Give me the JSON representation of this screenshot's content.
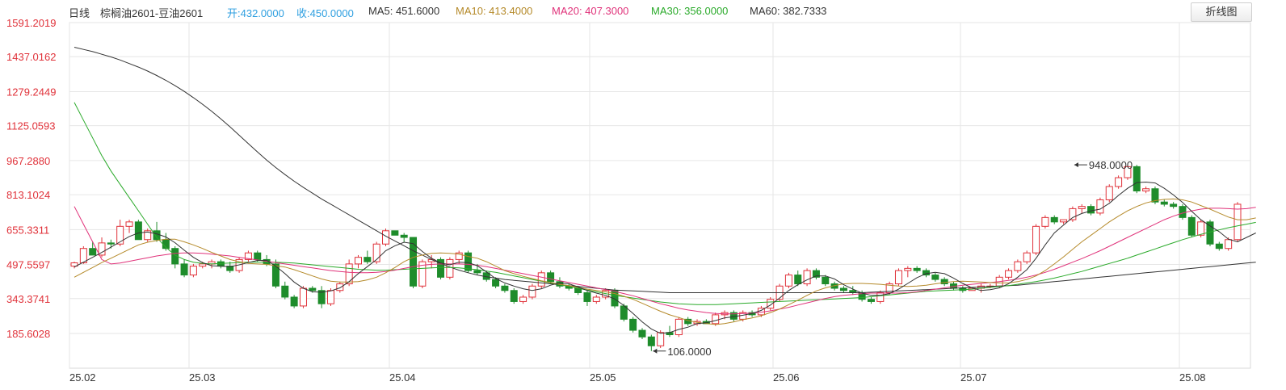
{
  "header": {
    "period": "日线",
    "instrument": "棕榈油2601-豆油2601",
    "open": "开:432.0000",
    "close": "收:450.0000",
    "ma5": "MA5: 451.6000",
    "ma10": "MA10: 413.4000",
    "ma20": "MA20: 407.3000",
    "ma30": "MA30: 356.0000",
    "ma60": "MA60: 382.7333",
    "toggle_label": "折线图"
  },
  "colors": {
    "up": "#e0323a",
    "down": "#1e8c2b",
    "open": "#2f9fe0",
    "close": "#2f9fe0",
    "ma5": "#333333",
    "ma10": "#b58a2a",
    "ma20": "#e0327a",
    "ma30": "#2aaa2a",
    "ma60": "#333333",
    "grid": "#e6e6e6"
  },
  "chart_data": {
    "type": "candlestick",
    "y_ticks": [
      "1591.2019",
      "1437.0162",
      "1279.2449",
      "1125.0593",
      "967.2880",
      "813.1024",
      "655.3311",
      "497.5597",
      "343.3741",
      "185.6028"
    ],
    "x_ticks": [
      "25.02",
      "25.03",
      "25.04",
      "25.05",
      "25.06",
      "25.07",
      "25.08"
    ],
    "annotations": [
      {
        "label": "948.0000",
        "value": 948,
        "index": 109
      },
      {
        "label": "106.0000",
        "value": 106,
        "index": 63
      }
    ],
    "ohlc": [
      [
        490,
        510,
        480,
        505
      ],
      [
        505,
        580,
        500,
        570
      ],
      [
        570,
        600,
        540,
        540
      ],
      [
        540,
        620,
        530,
        595
      ],
      [
        595,
        610,
        570,
        590
      ],
      [
        590,
        700,
        580,
        670
      ],
      [
        670,
        700,
        640,
        690
      ],
      [
        690,
        700,
        610,
        610
      ],
      [
        610,
        660,
        600,
        650
      ],
      [
        650,
        690,
        600,
        610
      ],
      [
        610,
        640,
        560,
        570
      ],
      [
        570,
        580,
        480,
        500
      ],
      [
        500,
        520,
        440,
        450
      ],
      [
        450,
        500,
        440,
        490
      ],
      [
        490,
        510,
        480,
        500
      ],
      [
        500,
        520,
        480,
        510
      ],
      [
        510,
        520,
        480,
        490
      ],
      [
        490,
        510,
        460,
        470
      ],
      [
        470,
        530,
        460,
        520
      ],
      [
        520,
        560,
        510,
        550
      ],
      [
        550,
        560,
        510,
        520
      ],
      [
        520,
        540,
        490,
        500
      ],
      [
        500,
        520,
        390,
        400
      ],
      [
        400,
        420,
        340,
        350
      ],
      [
        350,
        360,
        300,
        310
      ],
      [
        310,
        400,
        300,
        390
      ],
      [
        390,
        400,
        370,
        380
      ],
      [
        380,
        400,
        300,
        320
      ],
      [
        320,
        390,
        310,
        380
      ],
      [
        380,
        420,
        370,
        410
      ],
      [
        410,
        520,
        400,
        500
      ],
      [
        500,
        540,
        480,
        530
      ],
      [
        530,
        560,
        500,
        510
      ],
      [
        510,
        600,
        500,
        590
      ],
      [
        590,
        660,
        580,
        650
      ],
      [
        650,
        650,
        630,
        630
      ],
      [
        630,
        640,
        600,
        620
      ],
      [
        620,
        600,
        390,
        400
      ],
      [
        400,
        520,
        390,
        510
      ],
      [
        510,
        540,
        480,
        520
      ],
      [
        520,
        530,
        430,
        440
      ],
      [
        440,
        530,
        430,
        520
      ],
      [
        520,
        560,
        500,
        550
      ],
      [
        550,
        560,
        460,
        470
      ],
      [
        470,
        500,
        450,
        460
      ],
      [
        460,
        470,
        420,
        430
      ],
      [
        430,
        440,
        390,
        400
      ],
      [
        400,
        410,
        370,
        380
      ],
      [
        380,
        390,
        320,
        330
      ],
      [
        330,
        360,
        320,
        350
      ],
      [
        350,
        410,
        340,
        400
      ],
      [
        400,
        470,
        390,
        460
      ],
      [
        460,
        470,
        410,
        420
      ],
      [
        420,
        440,
        390,
        400
      ],
      [
        400,
        410,
        380,
        390
      ],
      [
        390,
        400,
        360,
        370
      ],
      [
        370,
        380,
        310,
        330
      ],
      [
        330,
        360,
        320,
        350
      ],
      [
        350,
        390,
        340,
        380
      ],
      [
        380,
        390,
        300,
        310
      ],
      [
        310,
        320,
        240,
        250
      ],
      [
        250,
        260,
        190,
        200
      ],
      [
        200,
        210,
        160,
        170
      ],
      [
        170,
        180,
        106,
        130
      ],
      [
        130,
        200,
        120,
        190
      ],
      [
        190,
        220,
        170,
        180
      ],
      [
        180,
        260,
        170,
        250
      ],
      [
        250,
        260,
        220,
        230
      ],
      [
        230,
        250,
        220,
        240
      ],
      [
        240,
        250,
        230,
        230
      ],
      [
        230,
        280,
        220,
        270
      ],
      [
        270,
        290,
        250,
        280
      ],
      [
        280,
        290,
        240,
        250
      ],
      [
        250,
        290,
        240,
        280
      ],
      [
        280,
        290,
        260,
        270
      ],
      [
        270,
        310,
        260,
        300
      ],
      [
        300,
        350,
        290,
        340
      ],
      [
        340,
        410,
        330,
        400
      ],
      [
        400,
        460,
        390,
        450
      ],
      [
        450,
        470,
        400,
        410
      ],
      [
        410,
        480,
        400,
        470
      ],
      [
        470,
        480,
        430,
        440
      ],
      [
        440,
        450,
        400,
        410
      ],
      [
        410,
        420,
        380,
        390
      ],
      [
        390,
        400,
        370,
        380
      ],
      [
        380,
        400,
        360,
        370
      ],
      [
        370,
        380,
        330,
        340
      ],
      [
        340,
        350,
        320,
        330
      ],
      [
        330,
        380,
        320,
        370
      ],
      [
        370,
        420,
        360,
        410
      ],
      [
        410,
        480,
        400,
        470
      ],
      [
        470,
        490,
        440,
        480
      ],
      [
        480,
        490,
        460,
        470
      ],
      [
        470,
        480,
        440,
        450
      ],
      [
        450,
        460,
        420,
        430
      ],
      [
        430,
        440,
        400,
        410
      ],
      [
        410,
        420,
        380,
        390
      ],
      [
        390,
        400,
        370,
        380
      ],
      [
        380,
        390,
        380,
        390
      ],
      [
        390,
        410,
        370,
        400
      ],
      [
        400,
        410,
        390,
        400
      ],
      [
        400,
        450,
        390,
        440
      ],
      [
        440,
        480,
        430,
        470
      ],
      [
        470,
        520,
        460,
        510
      ],
      [
        510,
        560,
        500,
        550
      ],
      [
        550,
        680,
        540,
        670
      ],
      [
        670,
        720,
        660,
        710
      ],
      [
        710,
        720,
        680,
        690
      ],
      [
        690,
        700,
        680,
        700
      ],
      [
        700,
        760,
        690,
        750
      ],
      [
        750,
        770,
        730,
        760
      ],
      [
        760,
        770,
        720,
        730
      ],
      [
        730,
        800,
        720,
        790
      ],
      [
        790,
        860,
        780,
        850
      ],
      [
        850,
        900,
        840,
        890
      ],
      [
        890,
        948,
        880,
        940
      ],
      [
        940,
        948,
        820,
        830
      ],
      [
        830,
        850,
        820,
        840
      ],
      [
        840,
        850,
        770,
        780
      ],
      [
        780,
        790,
        760,
        770
      ],
      [
        770,
        780,
        750,
        760
      ],
      [
        760,
        770,
        700,
        710
      ],
      [
        710,
        720,
        620,
        630
      ],
      [
        630,
        700,
        620,
        690
      ],
      [
        690,
        700,
        580,
        590
      ],
      [
        590,
        600,
        560,
        570
      ],
      [
        570,
        620,
        560,
        610
      ],
      [
        610,
        780,
        600,
        770
      ]
    ],
    "ma5": [
      486,
      508,
      530,
      552,
      576,
      600,
      624,
      640,
      644,
      636,
      622,
      596,
      562,
      530,
      506,
      492,
      490,
      488,
      496,
      506,
      516,
      516,
      490,
      456,
      418,
      390,
      374,
      372,
      378,
      392,
      420,
      456,
      488,
      520,
      560,
      582,
      598,
      592,
      556,
      526,
      504,
      496,
      508,
      506,
      492,
      464,
      434,
      414,
      400,
      388,
      380,
      388,
      404,
      414,
      410,
      396,
      380,
      368,
      358,
      342,
      312,
      276,
      238,
      206,
      186,
      190,
      204,
      214,
      230,
      234,
      244,
      256,
      262,
      268,
      276,
      290,
      314,
      346,
      380,
      406,
      428,
      446,
      446,
      432,
      406,
      386,
      368,
      358,
      358,
      366,
      386,
      412,
      438,
      456,
      462,
      456,
      436,
      412,
      392,
      380,
      384,
      392,
      410,
      440,
      474,
      526,
      586,
      640,
      676,
      710,
      728,
      740,
      748,
      774,
      810,
      842,
      868,
      870,
      866,
      842,
      812,
      778,
      738,
      700,
      672,
      646,
      612,
      600,
      620,
      640
    ],
    "ma10": [
      440,
      462,
      484,
      506,
      526,
      546,
      566,
      586,
      598,
      606,
      612,
      612,
      600,
      586,
      570,
      552,
      536,
      520,
      510,
      502,
      500,
      498,
      492,
      486,
      474,
      460,
      446,
      432,
      422,
      418,
      418,
      420,
      428,
      440,
      460,
      484,
      510,
      530,
      540,
      548,
      550,
      548,
      544,
      534,
      526,
      510,
      490,
      470,
      456,
      444,
      434,
      424,
      416,
      408,
      402,
      394,
      386,
      380,
      374,
      366,
      354,
      340,
      322,
      304,
      286,
      270,
      258,
      244,
      236,
      230,
      226,
      230,
      238,
      248,
      256,
      266,
      280,
      296,
      316,
      336,
      358,
      378,
      392,
      402,
      410,
      412,
      412,
      410,
      408,
      404,
      400,
      398,
      400,
      404,
      410,
      416,
      420,
      422,
      420,
      418,
      416,
      414,
      414,
      420,
      430,
      446,
      470,
      500,
      532,
      566,
      600,
      630,
      660,
      690,
      716,
      740,
      760,
      776,
      786,
      792,
      794,
      790,
      780,
      764,
      748,
      730,
      712,
      700,
      700,
      708
    ],
    "ma20": [
      760,
      680,
      600,
      520,
      500,
      504,
      512,
      520,
      528,
      536,
      542,
      548,
      550,
      550,
      548,
      544,
      540,
      536,
      530,
      524,
      518,
      512,
      506,
      500,
      494,
      488,
      482,
      476,
      470,
      466,
      462,
      460,
      460,
      462,
      466,
      472,
      480,
      488,
      494,
      498,
      500,
      500,
      500,
      498,
      494,
      488,
      480,
      472,
      464,
      456,
      448,
      440,
      432,
      424,
      416,
      408,
      400,
      392,
      384,
      376,
      366,
      356,
      344,
      332,
      320,
      310,
      300,
      292,
      286,
      280,
      276,
      274,
      274,
      276,
      278,
      282,
      288,
      296,
      304,
      314,
      324,
      334,
      344,
      352,
      358,
      362,
      366,
      368,
      368,
      368,
      368,
      370,
      374,
      380,
      386,
      392,
      398,
      404,
      408,
      412,
      416,
      420,
      426,
      432,
      440,
      450,
      462,
      476,
      492,
      508,
      524,
      542,
      560,
      580,
      600,
      620,
      640,
      660,
      680,
      700,
      716,
      730,
      740,
      748,
      752,
      752,
      750,
      748,
      750,
      756
    ],
    "ma30": [
      1230,
      1150,
      1070,
      990,
      920,
      860,
      800,
      740,
      680,
      620,
      575,
      540,
      520,
      508,
      502,
      500,
      502,
      504,
      506,
      508,
      508,
      508,
      508,
      506,
      504,
      500,
      496,
      492,
      488,
      484,
      480,
      476,
      474,
      472,
      472,
      474,
      476,
      478,
      480,
      482,
      484,
      484,
      482,
      478,
      474,
      468,
      462,
      454,
      446,
      438,
      430,
      422,
      414,
      406,
      398,
      390,
      382,
      374,
      366,
      358,
      352,
      346,
      340,
      334,
      328,
      324,
      320,
      318,
      316,
      316,
      316,
      318,
      320,
      322,
      324,
      326,
      328,
      330,
      332,
      334,
      336,
      338,
      340,
      342,
      344,
      346,
      348,
      352,
      356,
      360,
      364,
      368,
      372,
      376,
      378,
      380,
      382,
      384,
      386,
      390,
      394,
      398,
      402,
      408,
      414,
      420,
      428,
      436,
      446,
      456,
      466,
      478,
      490,
      502,
      514,
      526,
      540,
      554,
      568,
      582,
      596,
      610,
      622,
      634,
      644,
      654,
      664,
      672,
      680,
      688
    ],
    "ma60": [
      1480,
      1470,
      1460,
      1448,
      1436,
      1422,
      1406,
      1390,
      1372,
      1352,
      1330,
      1306,
      1280,
      1252,
      1222,
      1190,
      1156,
      1120,
      1082,
      1044,
      1006,
      970,
      936,
      904,
      874,
      846,
      820,
      794,
      770,
      746,
      722,
      698,
      674,
      650,
      626,
      604,
      582,
      560,
      540,
      520,
      502,
      486,
      472,
      460,
      450,
      442,
      436,
      430,
      426,
      422,
      418,
      414,
      410,
      406,
      402,
      398,
      394,
      390,
      386,
      382,
      380,
      378,
      376,
      374,
      372,
      370,
      370,
      370,
      370,
      370,
      370,
      370,
      370,
      370,
      370,
      370,
      370,
      370,
      370,
      370,
      370,
      370,
      370,
      370,
      370,
      370,
      370,
      372,
      374,
      376,
      378,
      380,
      382,
      384,
      386,
      388,
      390,
      392,
      394,
      396,
      398,
      400,
      402,
      404,
      408,
      412,
      416,
      420,
      424,
      428,
      432,
      436,
      440,
      444,
      448,
      452,
      456,
      460,
      464,
      468,
      472,
      476,
      480,
      484,
      488,
      492,
      496,
      500,
      504,
      508
    ]
  }
}
